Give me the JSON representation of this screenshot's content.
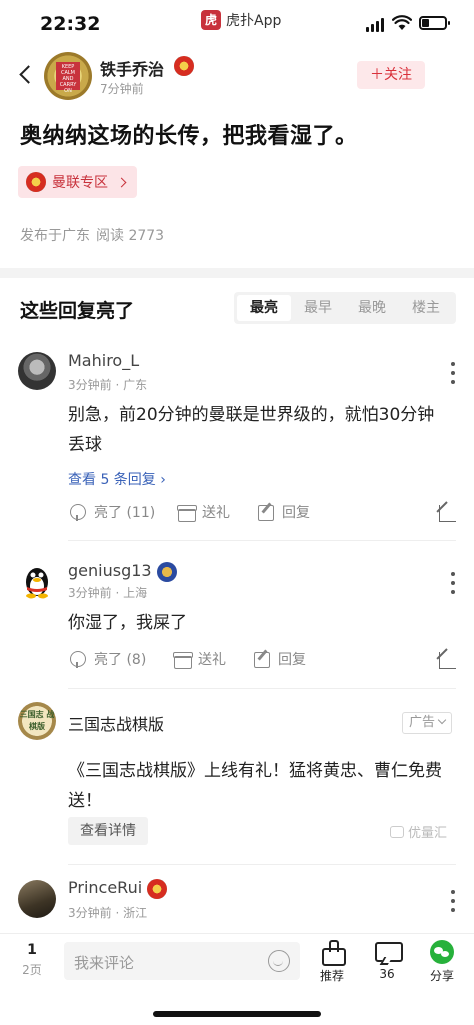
{
  "status_bar": {
    "time": "22:32",
    "app_name": "虎扑App",
    "app_icon_glyph": "虎扑"
  },
  "author": {
    "name": "铁手乔治",
    "time": "7分钟前",
    "follow_label": "＋关注",
    "avatar_text": "KEEP CALM AND CARRY ON"
  },
  "post": {
    "title": "奥纳纳这场的长传，把我看湿了。",
    "zone_label": "曼联专区",
    "location": "发布于广东",
    "reads_label": "阅读 2773"
  },
  "replies_section": {
    "title": "这些回复亮了",
    "sort_tabs": [
      "最亮",
      "最早",
      "最晚",
      "楼主"
    ],
    "active_tab": 0
  },
  "comments": [
    {
      "name": "Mahiro_L",
      "meta": "3分钟前 · 广东",
      "text": "别急，前20分钟的曼联是世界级的，就怕30分钟丢球",
      "replies_link": "查看 5 条回复 ›",
      "like": "亮了 (11)",
      "gift": "送礼",
      "reply": "回复"
    },
    {
      "name": "geniusg13",
      "meta": "3分钟前 · 上海",
      "text": "你湿了，我屎了",
      "like": "亮了 (8)",
      "gift": "送礼",
      "reply": "回复"
    },
    {
      "name": "PrinceRui",
      "meta": "3分钟前 · 浙江"
    }
  ],
  "ad": {
    "name": "三国志战棋版",
    "tag": "广告",
    "text": "《三国志战棋版》上线有礼！猛将黄忠、曹仁免费送！",
    "button": "查看详情",
    "source": "优量汇",
    "avatar_text": "三国志 战棋版"
  },
  "bottom_bar": {
    "page_current": "1",
    "page_total": "2页",
    "comment_placeholder": "我来评论",
    "recommend_label": "推荐",
    "comment_count": "36",
    "share_label": "分享"
  }
}
